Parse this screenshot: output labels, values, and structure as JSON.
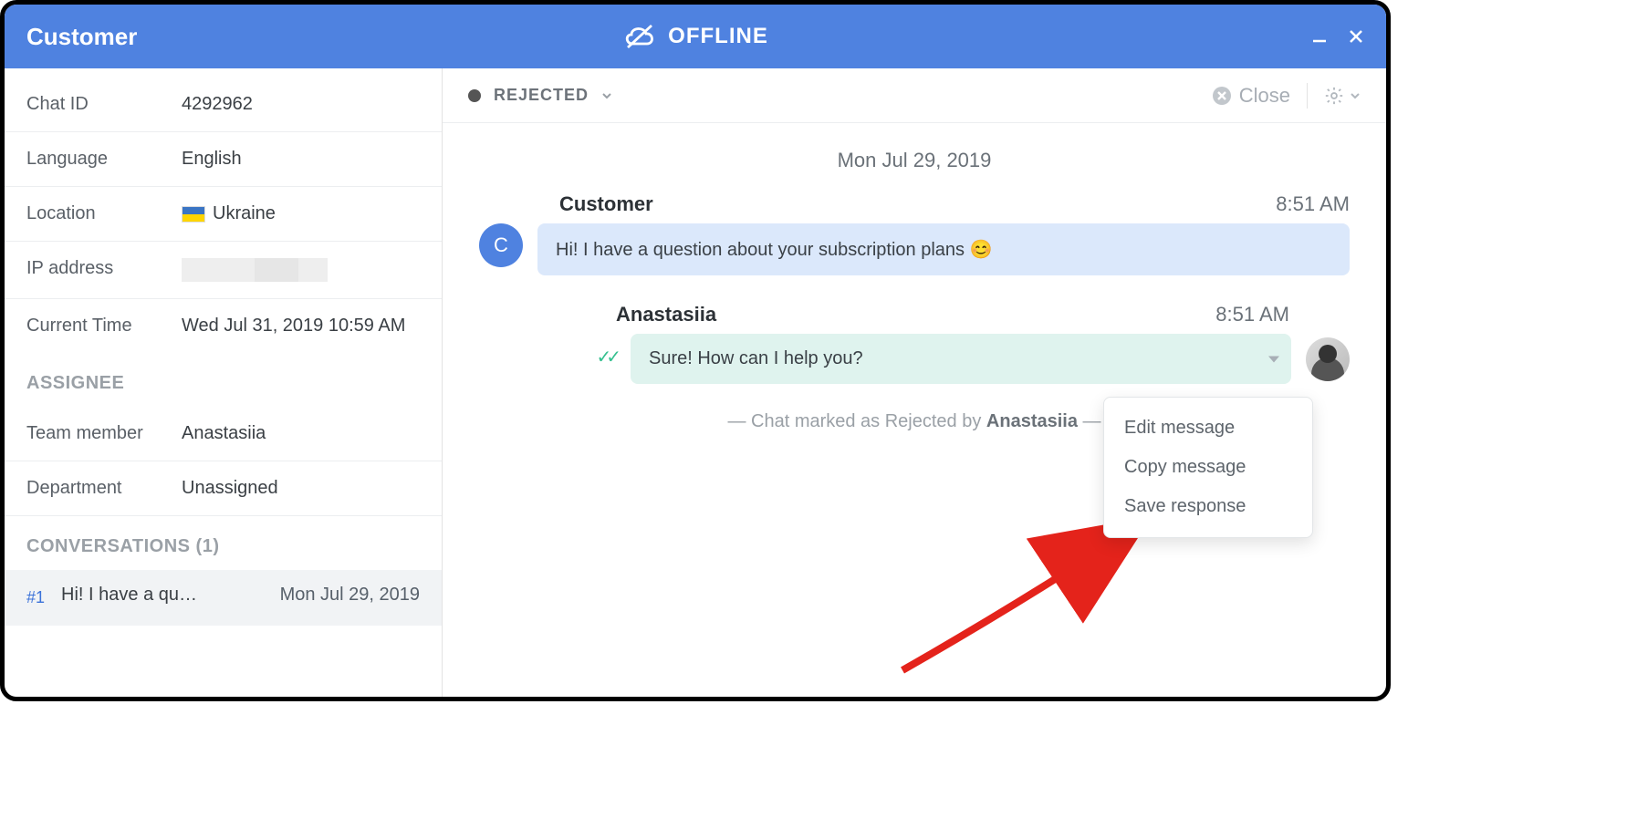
{
  "titlebar": {
    "title": "Customer",
    "status": "OFFLINE"
  },
  "sidebar": {
    "rows": {
      "chat_id_label": "Chat ID",
      "chat_id_value": "4292962",
      "lang_label": "Language",
      "lang_value": "English",
      "loc_label": "Location",
      "loc_value": "Ukraine",
      "ip_label": "IP address",
      "time_label": "Current Time",
      "time_value": "Wed Jul 31, 2019 10:59 AM"
    },
    "assignee_heading": "ASSIGNEE",
    "assignee": {
      "team_label": "Team member",
      "team_value": "Anastasiia",
      "dept_label": "Department",
      "dept_value": "Unassigned"
    },
    "conversations_heading": "CONVERSATIONS (1)",
    "conversation": {
      "num": "#1",
      "preview": "Hi! I have a qu…",
      "date": "Mon Jul 29, 2019"
    }
  },
  "toolbar": {
    "status": "REJECTED",
    "close": "Close"
  },
  "chat": {
    "date": "Mon Jul 29, 2019",
    "customer": {
      "name": "Customer",
      "time": "8:51 AM",
      "initial": "C",
      "text": "Hi! I have a question about your subscription plans  😊"
    },
    "agent": {
      "name": "Anastasiia",
      "time": "8:51 AM",
      "text": "Sure! How can I help you?"
    },
    "system_prefix": "— Chat marked as Rejected by ",
    "system_by": "Anastasiia",
    "system_suffix": " —"
  },
  "dropdown": {
    "edit": "Edit message",
    "copy": "Copy message",
    "save": "Save response"
  }
}
